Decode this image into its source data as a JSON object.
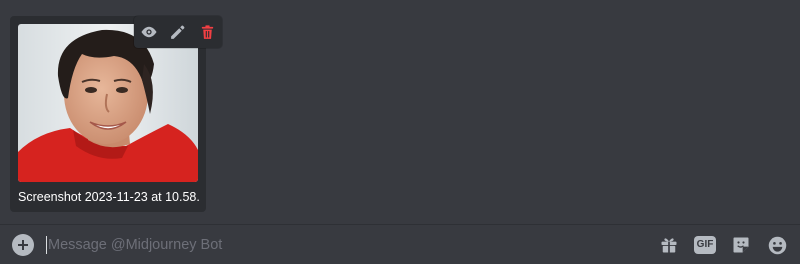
{
  "attachment": {
    "filename": "Screenshot 2023-11-23 at 10.58...",
    "actions": [
      {
        "name": "view",
        "icon": "eye-icon"
      },
      {
        "name": "edit",
        "icon": "pencil-icon"
      },
      {
        "name": "remove",
        "icon": "trash-icon"
      }
    ]
  },
  "composer": {
    "placeholder": "Message @Midjourney Bot",
    "value": "",
    "tools": {
      "gift_icon": "gift-icon",
      "gif_label": "GIF",
      "sticker_icon": "sticker-icon",
      "emoji_icon": "emoji-icon"
    }
  },
  "colors": {
    "background": "#383a40",
    "card": "#2b2d31",
    "icon": "#b5bac1",
    "danger": "#f23f43"
  }
}
